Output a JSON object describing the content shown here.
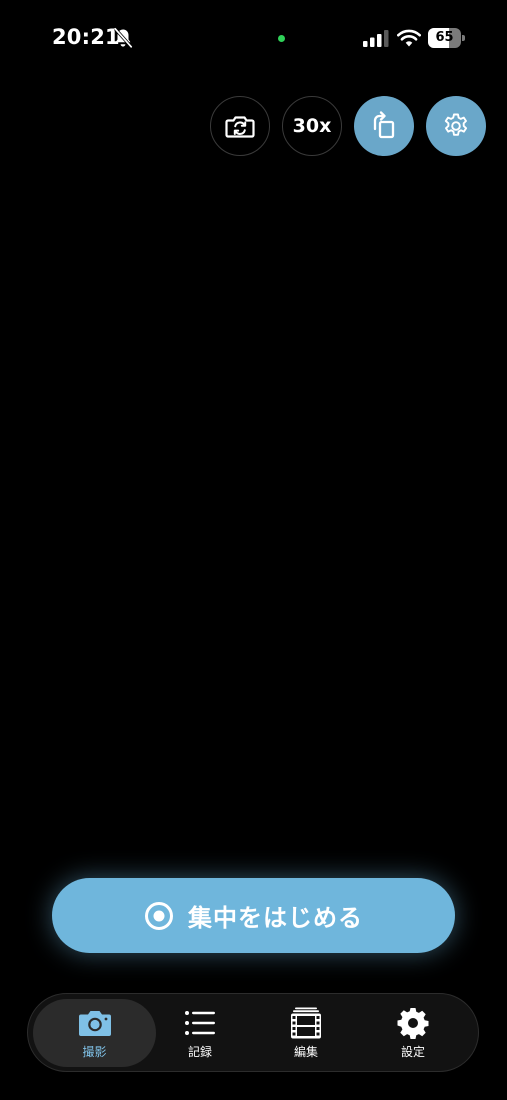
{
  "status_bar": {
    "time": "20:21",
    "battery_level": "65",
    "battery_fraction": 0.65,
    "icons": [
      "bell-slash-icon",
      "camera-in-use-dot",
      "cellular-signal-icon",
      "wifi-icon",
      "battery-icon"
    ]
  },
  "camera_controls": {
    "flip_icon": "camera-rotate-icon",
    "zoom_label": "30x",
    "rotate_icon": "rotate-orientation-icon",
    "settings_icon": "gear-icon"
  },
  "primary_action": {
    "label": "集中をはじめる",
    "icon": "record-icon"
  },
  "tab_bar": {
    "tabs": [
      {
        "label": "撮影",
        "icon": "camera-icon",
        "active": true
      },
      {
        "label": "記録",
        "icon": "list-icon",
        "active": false
      },
      {
        "label": "編集",
        "icon": "film-icon",
        "active": false
      },
      {
        "label": "設定",
        "icon": "gear-icon",
        "active": false
      }
    ]
  },
  "colors": {
    "background": "#000000",
    "accent": "#6fb6dc",
    "accent_button": "#6aa7c9",
    "active_tab_label": "#7fc0e6",
    "camera_indicator": "#2fd158"
  }
}
